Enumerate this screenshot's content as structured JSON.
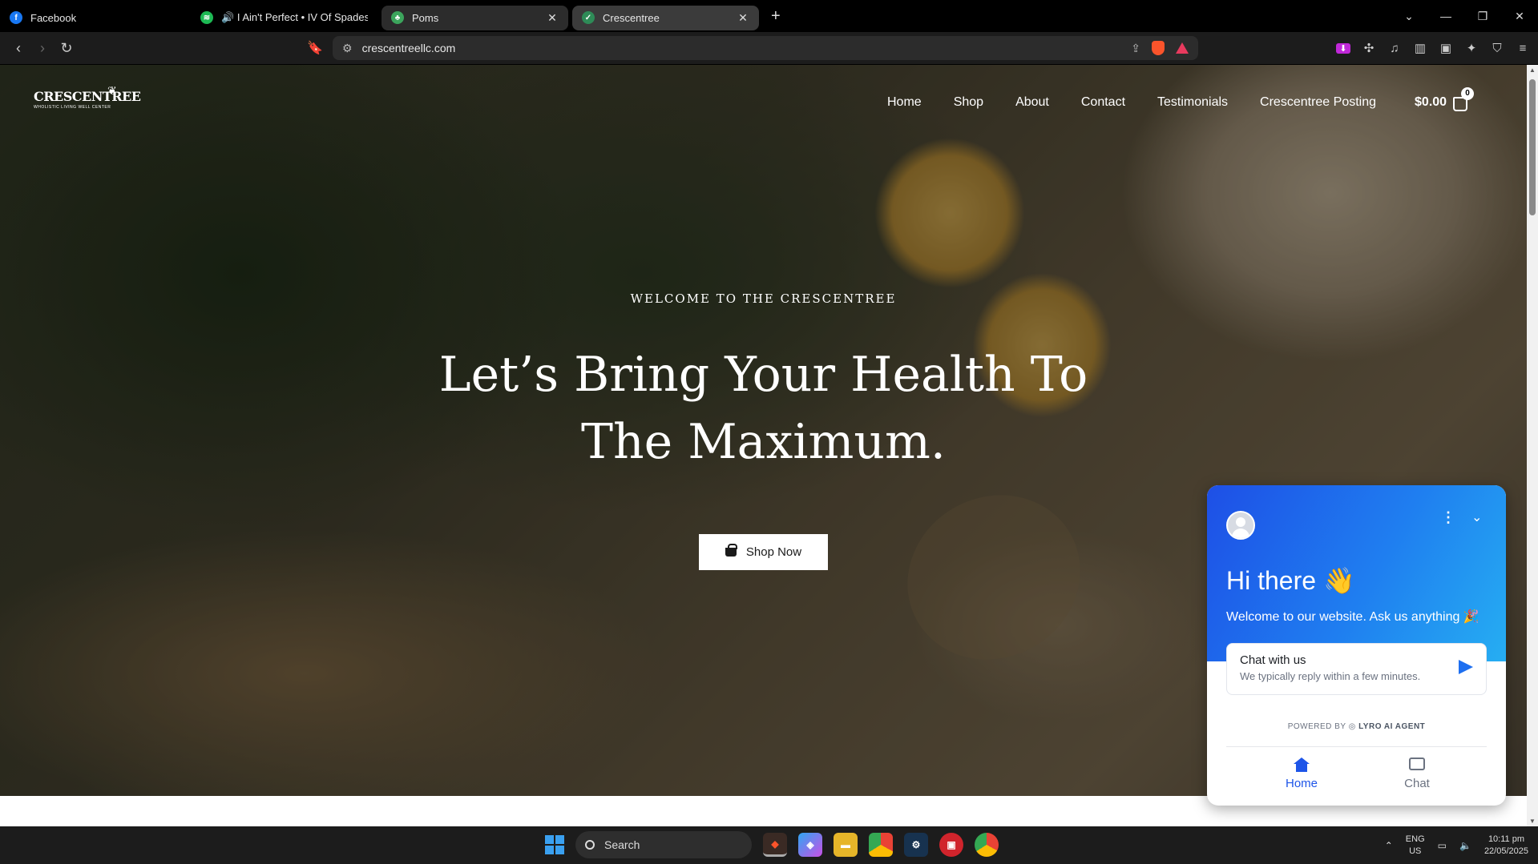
{
  "browser": {
    "tabs": [
      {
        "title": "Facebook",
        "icon": "facebook-icon",
        "color": "#1877f2",
        "state": "normal"
      },
      {
        "title": "I Ain't Perfect • IV Of Spades",
        "icon": "spotify-icon",
        "color": "#1db954",
        "state": "normal"
      },
      {
        "title": "Poms",
        "icon": "tree-icon",
        "color": "#3ca55c",
        "state": "hovered"
      },
      {
        "title": "Crescentree",
        "icon": "crescentree-icon",
        "color": "#2e8b57",
        "state": "active"
      }
    ],
    "new_tab_glyph": "+",
    "url": "crescentreellc.com"
  },
  "site": {
    "logo_name": "CRESCENTREE",
    "logo_tagline": "WHOLISTIC LIVING WELL CENTER",
    "nav": [
      "Home",
      "Shop",
      "About",
      "Contact",
      "Testimonials",
      "Crescentree Posting"
    ],
    "cart_total": "$0.00",
    "cart_count": "0"
  },
  "hero": {
    "eyebrow": "WELCOME TO THE CRESCENTREE",
    "title_line1": "Let’s Bring Your Health To",
    "title_line2": "The Maximum.",
    "cta_label": "Shop Now"
  },
  "chat_widget": {
    "greeting": "Hi there 👋",
    "welcome": "Welcome to our website. Ask us anything 🎉",
    "card_title": "Chat with us",
    "card_subtitle": "We typically reply within a few minutes.",
    "powered_prefix": "POWERED BY",
    "powered_brand": "LYRO AI AGENT",
    "tabs": [
      "Home",
      "Chat"
    ],
    "accent_color": "#1e55e8"
  },
  "taskbar": {
    "search_placeholder": "Search",
    "language": "ENG",
    "region": "US",
    "time": "10:11 pm",
    "date": "22/05/2025"
  }
}
